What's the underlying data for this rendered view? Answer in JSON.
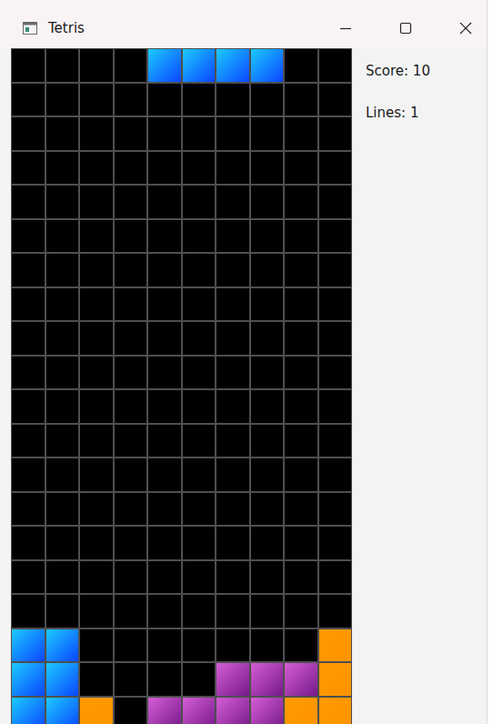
{
  "window": {
    "title": "Tetris"
  },
  "board": {
    "rows": [
      "....IIII..",
      "..........",
      "..........",
      "..........",
      "..........",
      "..........",
      "..........",
      "..........",
      "..........",
      "..........",
      "..........",
      "..........",
      "..........",
      "..........",
      "..........",
      "..........",
      "..........",
      "II.......L",
      "II....TTTL",
      "IIL.TTTTLL"
    ],
    "palette": {
      "I": {
        "color": "#1ccaff",
        "shade": "#0a46ff"
      },
      "T": {
        "color": "#d45ed4",
        "shade": "#76198a"
      },
      "L": {
        "color": "#ff9a00",
        "shade": "#ff9400"
      }
    }
  },
  "stats": [
    {
      "label": "Score: 10"
    },
    {
      "label": "Lines: 1"
    }
  ]
}
